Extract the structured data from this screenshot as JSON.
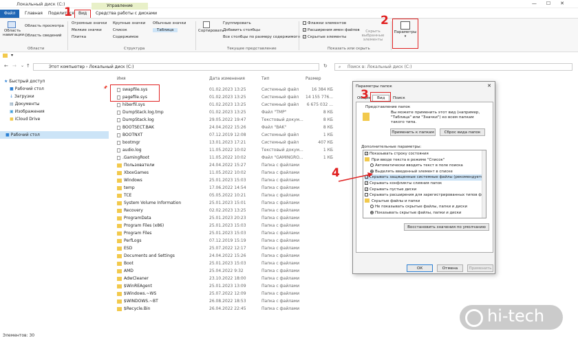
{
  "window": {
    "title": "Локальный диск (C:)"
  },
  "ribbon_tabs": {
    "management": "Управление",
    "file": "Файл",
    "home": "Главная",
    "share": "Поделиться",
    "view": "Вид",
    "disk_tools": "Средства работы с дисками"
  },
  "ribbon": {
    "panes": {
      "nav_pane": "Область навигации",
      "preview": "Область просмотра",
      "details": "Область сведений",
      "label": "Области"
    },
    "layout": {
      "huge": "Огромные значки",
      "large": "Крупные значки",
      "normal": "Обычные значки",
      "medium": "Мелкие значки",
      "small": "Список",
      "list": "Плитка",
      "tiles": "Содержимое",
      "table": "Таблица",
      "label": "Структура"
    },
    "current_view": {
      "sort": "Сортировать",
      "group": "Группировать",
      "add_columns": "Добавить столбцы",
      "fit_columns": "Все столбцы по размеру содержимого",
      "label": "Текущее представление"
    },
    "show_hide": {
      "checkboxes": "Флажки элементов",
      "extensions": "Расширения имен файлов",
      "hidden": "Скрытые элементы",
      "hide_selected": "Скрыть выбранные элементы",
      "label": "Показать или скрыть"
    },
    "options": "Параметры"
  },
  "address": {
    "path1": "Этот компьютер",
    "path2": "Локальный диск (C:)",
    "search_placeholder": "Поиск в: Локальный диск (C:)"
  },
  "nav": [
    "Быстрый доступ",
    "Рабочий стол",
    "Загрузки",
    "Документы",
    "Изображения",
    "iCloud Drive",
    "Рабочий стол"
  ],
  "columns": {
    "name": "Имя",
    "date": "Дата изменения",
    "type": "Тип",
    "size": "Размер"
  },
  "files": [
    {
      "name": "swapfile.sys",
      "date": "01.02.2023 13:25",
      "type": "Системный файл",
      "size": "16 384 КБ",
      "kind": "file"
    },
    {
      "name": "pagefile.sys",
      "date": "01.02.2023 13:25",
      "type": "Системный файл",
      "size": "14 155 776...",
      "kind": "file"
    },
    {
      "name": "hiberfil.sys",
      "date": "01.02.2023 13:25",
      "type": "Системный файл",
      "size": "6 675 032 ...",
      "kind": "file"
    },
    {
      "name": "DumpStack.log.tmp",
      "date": "01.02.2023 13:25",
      "type": "Файл \"TMP\"",
      "size": "8 КБ",
      "kind": "file"
    },
    {
      "name": "DumpStack.log",
      "date": "29.05.2022 19:47",
      "type": "Текстовый докум...",
      "size": "8 КБ",
      "kind": "file"
    },
    {
      "name": "BOOTSECT.BAK",
      "date": "24.04.2022 15:26",
      "type": "Файл \"BAK\"",
      "size": "8 КБ",
      "kind": "file"
    },
    {
      "name": "BOOTNXT",
      "date": "07.12.2019 12:08",
      "type": "Системный файл",
      "size": "1 КБ",
      "kind": "file"
    },
    {
      "name": "bootmgr",
      "date": "13.01.2023 17:21",
      "type": "Системный файл",
      "size": "407 КБ",
      "kind": "file"
    },
    {
      "name": "audio.log",
      "date": "11.05.2022 10:02",
      "type": "Текстовый докум...",
      "size": "1 КБ",
      "kind": "file"
    },
    {
      "name": ".GamingRoot",
      "date": "11.05.2022 10:02",
      "type": "Файл \"GAMINGRO...",
      "size": "1 КБ",
      "kind": "file"
    },
    {
      "name": "Пользователи",
      "date": "24.04.2022 15:27",
      "type": "Папка с файлами",
      "size": "",
      "kind": "folder"
    },
    {
      "name": "XboxGames",
      "date": "11.05.2022 10:02",
      "type": "Папка с файлами",
      "size": "",
      "kind": "folder"
    },
    {
      "name": "Windows",
      "date": "25.01.2023 15:03",
      "type": "Папка с файлами",
      "size": "",
      "kind": "folder"
    },
    {
      "name": "temp",
      "date": "17.06.2022 14:54",
      "type": "Папка с файлами",
      "size": "",
      "kind": "folder"
    },
    {
      "name": "TCE",
      "date": "05.05.2022 10:21",
      "type": "Папка с файлами",
      "size": "",
      "kind": "folder"
    },
    {
      "name": "System Volume Information",
      "date": "25.01.2023 15:01",
      "type": "Папка с файлами",
      "size": "",
      "kind": "folder"
    },
    {
      "name": "Recovery",
      "date": "02.02.2023 13:25",
      "type": "Папка с файлами",
      "size": "",
      "kind": "folder"
    },
    {
      "name": "ProgramData",
      "date": "25.01.2023 20:23",
      "type": "Папка с файлами",
      "size": "",
      "kind": "folder"
    },
    {
      "name": "Program Files (x86)",
      "date": "25.01.2023 15:03",
      "type": "Папка с файлами",
      "size": "",
      "kind": "folder"
    },
    {
      "name": "Program Files",
      "date": "25.01.2023 15:03",
      "type": "Папка с файлами",
      "size": "",
      "kind": "folder"
    },
    {
      "name": "PerfLogs",
      "date": "07.12.2019 15:19",
      "type": "Папка с файлами",
      "size": "",
      "kind": "folder"
    },
    {
      "name": "ESD",
      "date": "25.07.2022 12:17",
      "type": "Папка с файлами",
      "size": "",
      "kind": "folder"
    },
    {
      "name": "Documents and Settings",
      "date": "24.04.2022 15:26",
      "type": "Папка с файлами",
      "size": "",
      "kind": "folder"
    },
    {
      "name": "Boot",
      "date": "25.01.2023 15:03",
      "type": "Папка с файлами",
      "size": "",
      "kind": "folder"
    },
    {
      "name": "AMD",
      "date": "25.04.2022 9:32",
      "type": "Папка с файлами",
      "size": "",
      "kind": "folder"
    },
    {
      "name": "AdwCleaner",
      "date": "23.10.2022 18:00",
      "type": "Папка с файлами",
      "size": "",
      "kind": "folder"
    },
    {
      "name": "$WinREAgent",
      "date": "25.01.2023 13:09",
      "type": "Папка с файлами",
      "size": "",
      "kind": "folder"
    },
    {
      "name": "$Windows.~WS",
      "date": "25.07.2022 12:09",
      "type": "Папка с файлами",
      "size": "",
      "kind": "folder"
    },
    {
      "name": "$WINDOWS.~BT",
      "date": "26.08.2022 18:53",
      "type": "Папка с файлами",
      "size": "",
      "kind": "folder"
    },
    {
      "name": "$Recycle.Bin",
      "date": "26.04.2022 22:45",
      "type": "Папка с файлами",
      "size": "",
      "kind": "folder"
    }
  ],
  "status": "Элементов: 30",
  "dialog": {
    "title": "Параметры папок",
    "tabs": [
      "Общие",
      "Вид",
      "Поиск"
    ],
    "folder_view_label": "Представление папок",
    "folder_view_text": [
      "Вы можете применить этот вид (например,",
      "\"Таблица\" или \"Значки\") ко всем папкам",
      "такого типа."
    ],
    "apply_btn": "Применить к папкам",
    "reset_btn": "Сброс вида папок",
    "advanced_label": "Дополнительные параметры:",
    "tree": [
      {
        "text": "Показывать строку состояния",
        "mark": "check",
        "on": true,
        "indent": 0
      },
      {
        "text": "При вводе текста в режиме \"Список\"",
        "mark": "folder",
        "on": false,
        "indent": 0
      },
      {
        "text": "Автоматически вводить текст в поле поиска",
        "mark": "radio",
        "on": false,
        "indent": 1
      },
      {
        "text": "Выделять введенный элемент в списке",
        "mark": "radio",
        "on": true,
        "indent": 1
      },
      {
        "text": "Скрывать защищенные системные файлы (рекомендуется)",
        "mark": "check",
        "on": false,
        "indent": 0
      },
      {
        "text": "Скрывать конфликты слияния папок",
        "mark": "check",
        "on": true,
        "indent": 0
      },
      {
        "text": "Скрывать пустые диски",
        "mark": "check",
        "on": true,
        "indent": 0
      },
      {
        "text": "Скрывать расширения для зарегистрированных типов ф",
        "mark": "check",
        "on": false,
        "indent": 0
      },
      {
        "text": "Скрытые файлы и папки",
        "mark": "folder",
        "on": false,
        "indent": 0
      },
      {
        "text": "Не показывать скрытые файлы, папки и диски",
        "mark": "radio",
        "on": false,
        "indent": 1
      },
      {
        "text": "Показывать скрытые файлы, папки и диски",
        "mark": "radio",
        "on": true,
        "indent": 1
      }
    ],
    "restore_btn": "Восстановить значения по умолчанию",
    "ok": "ОК",
    "cancel": "Отмена",
    "apply": "Применить"
  },
  "annotations": {
    "n1": "1",
    "n2": "2",
    "n3": "3",
    "n4": "4"
  },
  "watermark": "hi-tech",
  "colors": {
    "accent": "#1e66b5",
    "annotation": "#e02020",
    "folder": "#f2c94c"
  }
}
